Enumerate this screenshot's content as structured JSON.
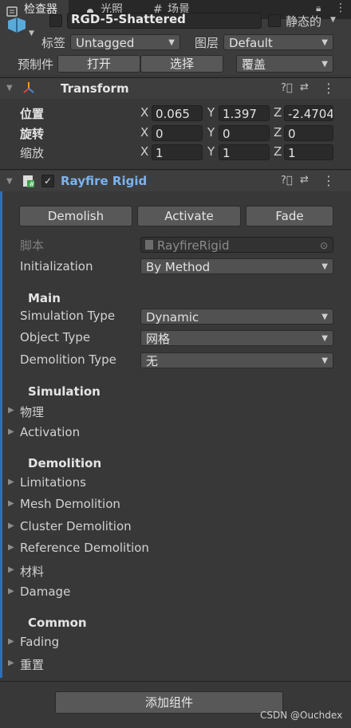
{
  "tabs": [
    {
      "label": "检查器",
      "icon": "inspector-icon"
    },
    {
      "label": "光照",
      "icon": "bulb-icon"
    },
    {
      "label": "场景",
      "icon": "grid-icon"
    }
  ],
  "header": {
    "object_name": "RGD-5-Shattered",
    "static_label": "静态的",
    "tag_label": "标签",
    "tag_value": "Untagged",
    "layer_label": "图层",
    "layer_value": "Default",
    "prefab_label": "预制件",
    "prefab_open": "打开",
    "prefab_select": "选择",
    "prefab_override": "覆盖"
  },
  "transform": {
    "title": "Transform",
    "position_label": "位置",
    "rotation_label": "旋转",
    "scale_label": "缩放",
    "axes": [
      "X",
      "Y",
      "Z"
    ],
    "position": [
      "0.065",
      "1.397",
      "-2.4704"
    ],
    "rotation": [
      "0",
      "0",
      "0"
    ],
    "scale": [
      "1",
      "1",
      "1"
    ]
  },
  "rayfire": {
    "title": "Rayfire Rigid",
    "demolish": "Demolish",
    "activate": "Activate",
    "fade": "Fade",
    "script_label": "脚本",
    "script_value": "RayfireRigid",
    "initialization_label": "Initialization",
    "initialization_value": "By Method",
    "main_header": "Main",
    "simulation_type_label": "Simulation Type",
    "simulation_type_value": "Dynamic",
    "object_type_label": "Object Type",
    "object_type_value": "网格",
    "demolition_type_label": "Demolition Type",
    "demolition_type_value": "无",
    "simulation_header": "Simulation",
    "simulation_items": [
      "物理",
      "Activation"
    ],
    "demolition_header": "Demolition",
    "demolition_items": [
      "Limitations",
      "Mesh Demolition",
      "Cluster Demolition",
      "Reference Demolition",
      "材料",
      "Damage"
    ],
    "common_header": "Common",
    "common_items": [
      "Fading",
      "重置"
    ]
  },
  "footer": {
    "add_component": "添加组件",
    "watermark": "CSDN @Ouchdex"
  }
}
